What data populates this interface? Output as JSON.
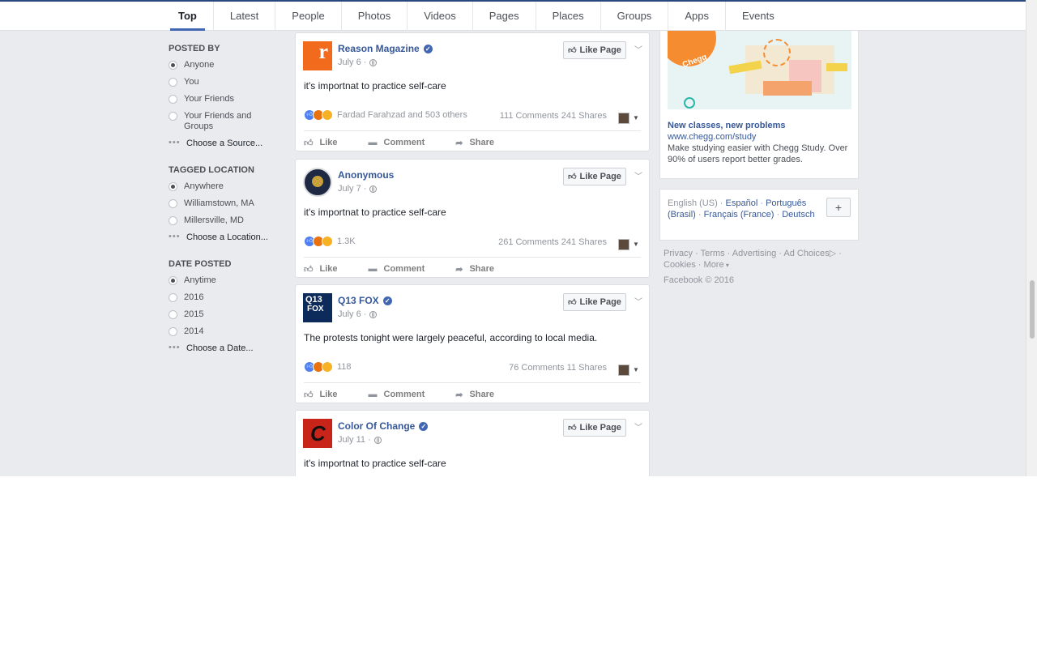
{
  "tabs": [
    "Top",
    "Latest",
    "People",
    "Photos",
    "Videos",
    "Pages",
    "Places",
    "Groups",
    "Apps",
    "Events"
  ],
  "filters": {
    "posted_by": {
      "heading": "POSTED BY",
      "options": [
        "Anyone",
        "You",
        "Your Friends",
        "Your Friends and Groups"
      ],
      "choose": "Choose a Source..."
    },
    "tagged_location": {
      "heading": "TAGGED LOCATION",
      "options": [
        "Anywhere",
        "Williamstown, MA",
        "Millersville, MD"
      ],
      "choose": "Choose a Location..."
    },
    "date_posted": {
      "heading": "DATE POSTED",
      "options": [
        "Anytime",
        "2016",
        "2015",
        "2014"
      ],
      "choose": "Choose a Date..."
    }
  },
  "posts": [
    {
      "name": "Reason Magazine",
      "date": "July 6 ·",
      "text": "it's importnat to practice self-care",
      "reactions": "Fardad Farahzad and 503 others",
      "stats": "111 Comments  241 Shares",
      "like_page": "Like Page"
    },
    {
      "name": "Anonymous",
      "date": "July 7 ·",
      "text": "it's importnat to practice self-care",
      "reactions": "1.3K",
      "stats": "261 Comments  241 Shares",
      "like_page": "Like Page"
    },
    {
      "name": "Q13 FOX",
      "date": "July 6 ·",
      "text": "The protests tonight were largely peaceful, according to local media.",
      "reactions": "118",
      "stats": "76 Comments  11 Shares",
      "like_page": "Like Page"
    },
    {
      "name": "Color Of Change",
      "date": "July 11 ·",
      "text": "it's importnat to practice self-care",
      "reactions": "",
      "stats": "",
      "like_page": "Like Page"
    }
  ],
  "actions": {
    "like": "Like",
    "comment": "Comment",
    "share": "Share"
  },
  "avatar_labels": {
    "reason": "r",
    "q13_top": "Q13",
    "q13_bottom": "FOX",
    "coc": "C"
  },
  "ad": {
    "image_text": "Chegg",
    "title": "New classes, new problems",
    "url": "www.chegg.com/study",
    "description": "Make studying easier with Chegg Study. Over 90% of users report better grades."
  },
  "languages": {
    "current": "English (US)",
    "others": [
      "Español",
      "Português (Brasil)",
      "Français (France)",
      "Deutsch"
    ],
    "plus": "+"
  },
  "footer": {
    "links": [
      "Privacy",
      "Terms",
      "Advertising",
      "Ad Choices",
      "Cookies",
      "More"
    ],
    "copyright": "Facebook © 2016"
  },
  "colors": {
    "brand_blue": "#4267b2",
    "link_blue": "#365899",
    "background": "#e9ebee"
  }
}
